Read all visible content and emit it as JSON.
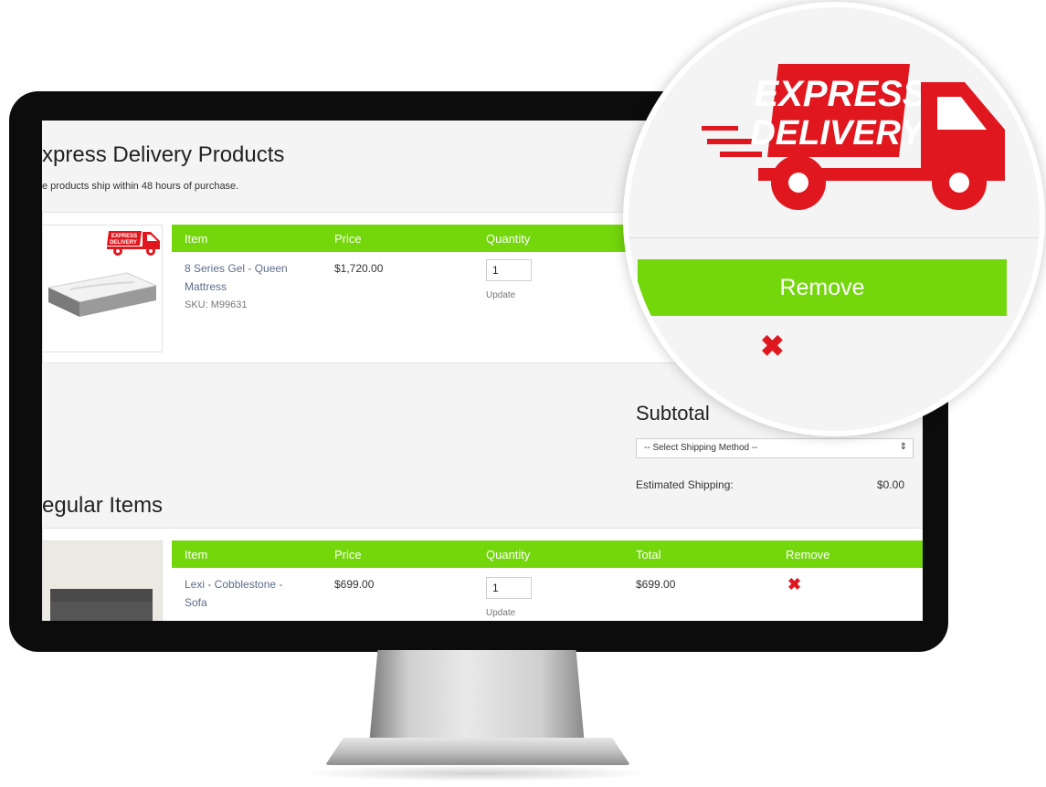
{
  "express": {
    "title": "xpress Delivery Products",
    "subtitle": "e products ship within 48 hours of purchase.",
    "badge_text": [
      "EXPRESS",
      "DELIVERY"
    ],
    "columns": [
      "Item",
      "Price",
      "Quantity"
    ],
    "item": {
      "name_line1": "8 Series Gel - Queen",
      "name_line2": "Mattress",
      "sku": "SKU: M99631",
      "price": "$1,720.00",
      "quantity": "1",
      "update_label": "Update"
    }
  },
  "summary": {
    "title": "Subtotal",
    "shipping_select": "-- Select Shipping Method --",
    "estimated_label": "Estimated Shipping:",
    "estimated_value": "$0.00"
  },
  "regular": {
    "title": "egular Items",
    "columns": [
      "Item",
      "Price",
      "Quantity",
      "Total",
      "Remove"
    ],
    "item": {
      "name_line1": "Lexi - Cobblestone -",
      "name_line2": "Sofa",
      "price": "$699.00",
      "quantity": "1",
      "update_label": "Update",
      "total": "$699.00",
      "remove_icon": "close-icon"
    }
  },
  "zoom": {
    "logo_line1": "EXPRESS",
    "logo_line2": "DELIVERY",
    "remove_label": "Remove",
    "remove_icon": "close-icon"
  },
  "colors": {
    "accent_green": "#74d70c",
    "delivery_red": "#e0171f",
    "bezel": "#0c0c0c"
  }
}
